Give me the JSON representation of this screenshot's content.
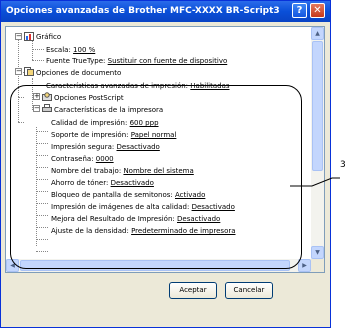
{
  "window": {
    "title": "Opciones avanzadas de Brother MFC-XXXX BR-Script3",
    "help_label": "?",
    "close_label": "✕"
  },
  "tree": {
    "graphic": {
      "label": "Gráfico",
      "items": [
        {
          "label": "Escala:",
          "value": "100 %"
        },
        {
          "label": "Fuente TrueType:",
          "value": "Sustituir con fuente de dispositivo"
        }
      ]
    },
    "document": {
      "label": "Opciones de documento",
      "items": [
        {
          "label": "Características avanzadas de impresión:",
          "value": "Habilitadas"
        }
      ],
      "postscript_label": "Opciones PostScript"
    },
    "printer": {
      "label": "Características de la impresora",
      "items": [
        {
          "label": "Calidad de impresión:",
          "value": "600 ppp"
        },
        {
          "label": "Soporte de impresión:",
          "value": "Papel normal"
        },
        {
          "label": "Impresión segura:",
          "value": "Desactivado"
        },
        {
          "label": "Contraseña:",
          "value": "0000"
        },
        {
          "label": "Nombre del trabajo:",
          "value": "Nombre del sistema"
        },
        {
          "label": "Ahorro de tóner:",
          "value": "Desactivado"
        },
        {
          "label": "Bloqueo de pantalla de semitonos:",
          "value": "Activado"
        },
        {
          "label": "Impresión de imágenes de alta calidad:",
          "value": "Desactivado"
        },
        {
          "label": "Mejora del Resultado de Impresión:",
          "value": "Desactivado"
        },
        {
          "label": "Ajuste de la densidad:",
          "value": "Predeterminado de impresora"
        }
      ]
    }
  },
  "callout": {
    "label": "3"
  },
  "buttons": {
    "accept": "Aceptar",
    "cancel": "Cancelar"
  },
  "colors": {
    "titlebar": "#0a4fd8",
    "panel_border": "#7f9db9",
    "dialog_bg": "#ece9d8"
  }
}
